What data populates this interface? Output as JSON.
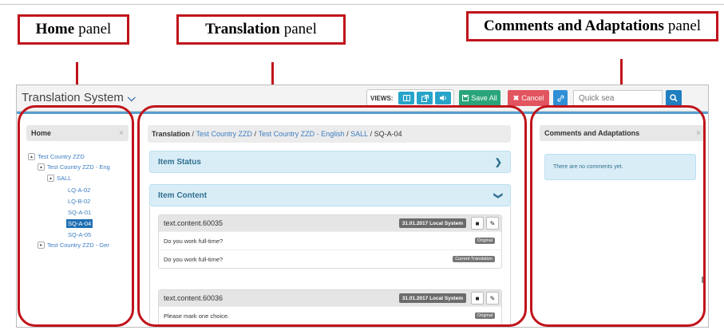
{
  "callouts": {
    "home": {
      "bold": "Home",
      "rest": "panel"
    },
    "translation": {
      "bold": "Translation",
      "rest": "panel"
    },
    "comments": {
      "bold": "Comments and Adaptations",
      "rest": "panel"
    }
  },
  "navbar": {
    "title": "Translation System",
    "views_label": "VIEWS:",
    "save_label": "Save All",
    "cancel_label": "Cancel",
    "search_placeholder": "Quick sea"
  },
  "home_panel": {
    "title": "Home",
    "close": "×",
    "tree": [
      {
        "label": "Test Country ZZD",
        "toggle": "▴"
      },
      {
        "label": "Test Country ZZD - Eng",
        "toggle": "▴"
      },
      {
        "label": "SALL",
        "toggle": "▴"
      },
      {
        "label": "LQ-A-02"
      },
      {
        "label": "LQ-B-02"
      },
      {
        "label": "SQ-A-01"
      },
      {
        "label": "SQ-A-04",
        "active": true
      },
      {
        "label": "SQ-A-05"
      },
      {
        "label": "Test Country ZZD - Ger",
        "toggle": "▸"
      }
    ]
  },
  "translation_panel": {
    "breadcrumb": {
      "root": "Translation",
      "sep": " / ",
      "links": [
        "Test Country ZZD",
        "Test Country ZZD - English",
        "SALL"
      ],
      "current": "SQ-A-04"
    },
    "item_status_label": "Item Status",
    "item_content_label": "Item Content",
    "cards": [
      {
        "key": "text.content.60035",
        "date": "31.01.2017 Local System",
        "rows": [
          {
            "text": "Do you work full-time?",
            "tag": "Original"
          },
          {
            "text": "Do you work full-time?",
            "tag": "Current Translation"
          }
        ]
      },
      {
        "key": "text.content.60036",
        "date": "31.01.2017 Local System",
        "rows": [
          {
            "text": "Please mark one choice.",
            "tag": "Original"
          }
        ]
      }
    ]
  },
  "comments_panel": {
    "title": "Comments and Adaptations",
    "close": "×",
    "empty_message": "There are no comments yet."
  },
  "colors": {
    "annotation_red": "#c0131b",
    "accent_blue": "#1f7fc0",
    "save_green": "#2aa57a",
    "cancel_red": "#e2545f",
    "info_bg": "#d9edf7"
  }
}
